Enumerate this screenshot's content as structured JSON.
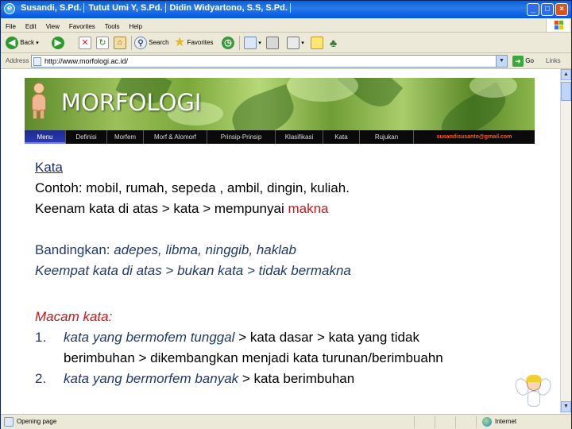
{
  "window": {
    "title_parts": [
      "Susandi, S.Pd.",
      "Tutut Umi Y, S.Pd.",
      "Didin Widyartono, S.S, S.Pd."
    ],
    "controls": [
      "_",
      "□",
      "×"
    ]
  },
  "menubar": {
    "items": [
      "File",
      "Edit",
      "View",
      "Favorites",
      "Tools",
      "Help"
    ]
  },
  "toolbar": {
    "back_label": "Back",
    "search_label": "Search",
    "favorites_label": "Favorites"
  },
  "address": {
    "label": "Address",
    "url": "http://www.morfologi.ac.id/",
    "go_label": "Go",
    "links_label": "Links"
  },
  "page": {
    "banner_title": "MORFOLOGI",
    "nav": [
      "Menu",
      "Definisi",
      "Morfem",
      "Morf & Alomorf",
      "Prinsip-Prinsip",
      "Klasifikasi",
      "Kata",
      "Rujukan"
    ],
    "nav_active": "Menu",
    "email": "susandisusanto@gmail.com",
    "heading": "Kata",
    "contoh_line": "Contoh: mobil, rumah, sepeda , ambil, dingin, kuliah.",
    "keenam_prefix": "Keenam kata di atas > kata > mempunyai ",
    "keenam_highlight": "makna",
    "bandingkan_prefix": "Bandingkan: ",
    "bandingkan_words": "adepes, libma, ninggib, haklab",
    "keempat_line": "Keempat kata di atas > bukan kata > tidak bermakna",
    "macam_heading": "Macam kata:",
    "list": [
      {
        "num": "1.",
        "emph": "kata yang bermofem tunggal",
        "rest": " > kata dasar > kata yang tidak",
        "cont": "berimbuhan > dikembangkan menjadi kata turunan/berimbuahn"
      },
      {
        "num": "2.",
        "emph": "kata yang bermorfem banyak",
        "rest": " > kata berimbuhan"
      }
    ]
  },
  "status": {
    "text": "Opening page",
    "zone": "Internet"
  },
  "colors": {
    "accent_red": "#c41a1a",
    "accent_navy": "#1f3a6b",
    "nav_active": "#2c39b3",
    "email": "#ff5a2a"
  }
}
